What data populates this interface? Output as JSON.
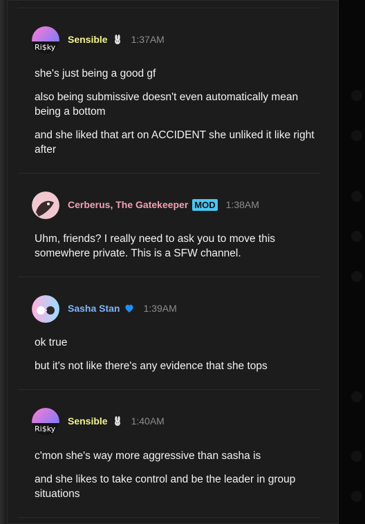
{
  "messages": [
    {
      "author": "Sensible",
      "author_badge_icon": "rabbit-icon",
      "time": "1:37AM",
      "avatar_text": "Ri$ky",
      "lines": [
        "she's just being a good gf",
        "also being submissive doesn't even automatically mean being a bottom",
        "and she liked that art on ACCIDENT she unliked it like right after"
      ]
    },
    {
      "author": "Cerberus, The Gatekeeper",
      "role_badge": "MOD",
      "time": "1:38AM",
      "lines": [
        "Uhm, friends? I really need to ask you to move this somewhere private. This is a SFW channel."
      ]
    },
    {
      "author": "Sasha Stan",
      "author_badge_icon": "blue-heart-icon",
      "time": "1:39AM",
      "lines": [
        "ok true",
        "but it's not like there's any evidence that she tops"
      ]
    },
    {
      "author": "Sensible",
      "author_badge_icon": "rabbit-icon",
      "time": "1:40AM",
      "avatar_text": "Ri$ky",
      "lines": [
        "c'mon she's way more aggressive than sasha is",
        "and she likes to take control and be the leader in group situations"
      ]
    }
  ],
  "colors": {
    "background": "#1c1c1c",
    "sensible_name": "#f3f28c",
    "cerberus_name": "#f4a1b3",
    "sasha_name": "#7fb4f8",
    "mod_badge": "#4bc6f2",
    "timestamp": "#8d8d8d",
    "message_text": "#f2f2f2"
  }
}
